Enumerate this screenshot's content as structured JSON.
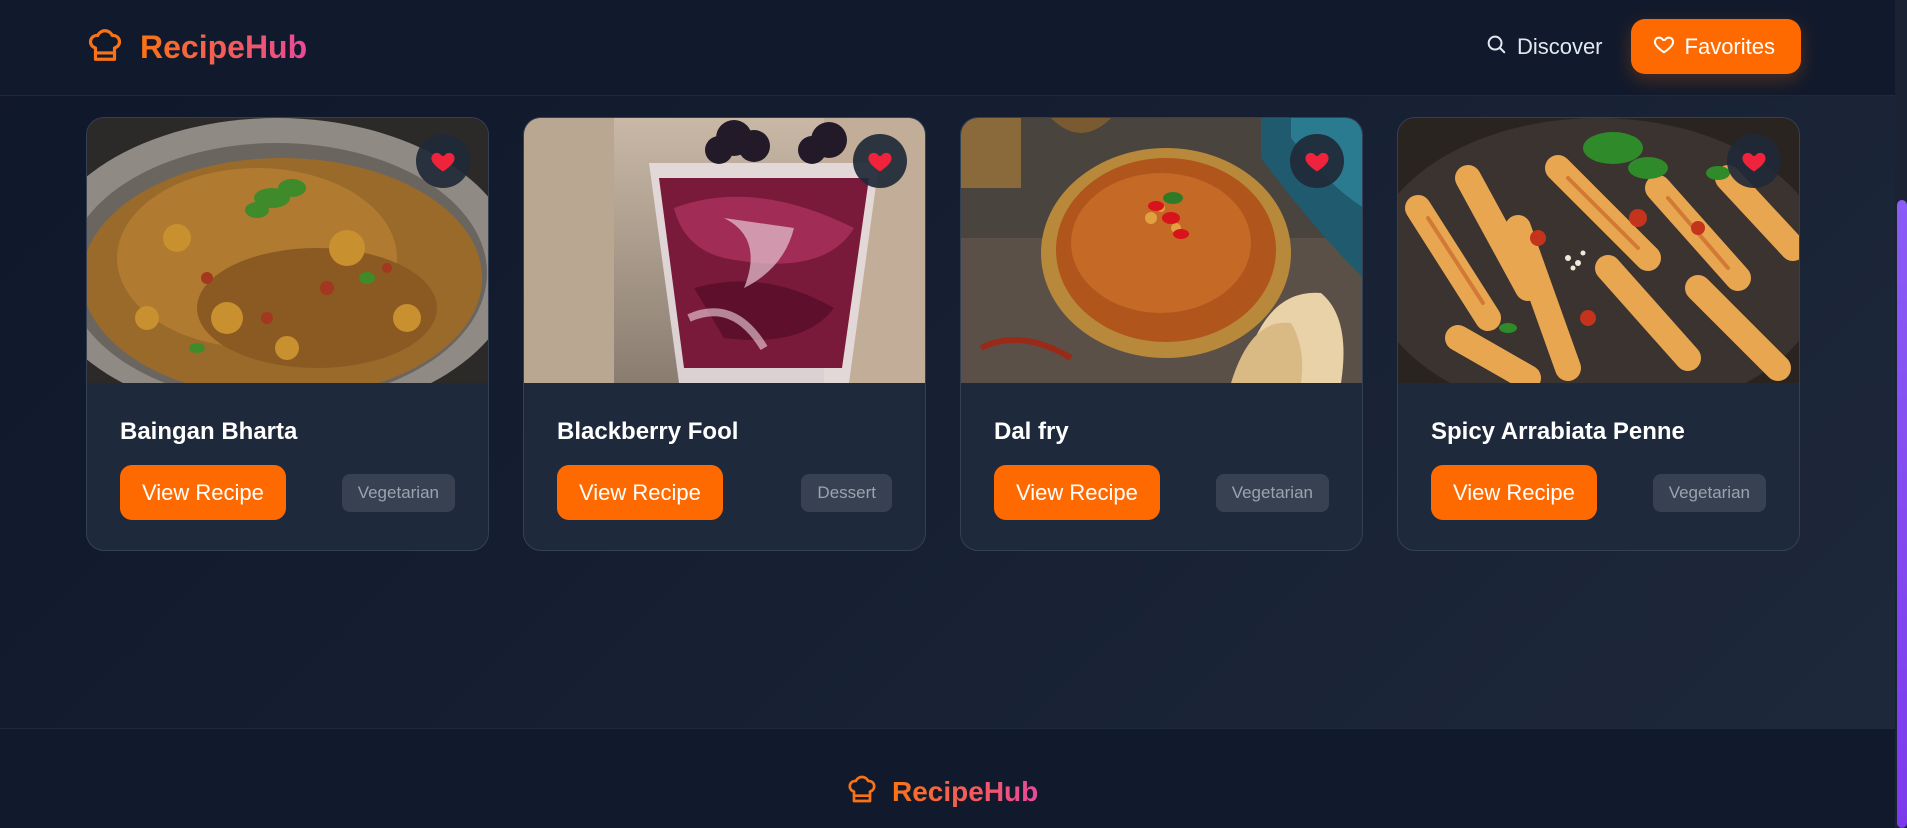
{
  "header": {
    "brand": "RecipeHub",
    "nav": {
      "discover_label": "Discover",
      "favorites_label": "Favorites"
    }
  },
  "recipes": [
    {
      "title": "Baingan Bharta",
      "button_label": "View Recipe",
      "tag": "Vegetarian",
      "image": "baingan-bharta-photo"
    },
    {
      "title": "Blackberry Fool",
      "button_label": "View Recipe",
      "tag": "Dessert",
      "image": "blackberry-fool-photo"
    },
    {
      "title": "Dal fry",
      "button_label": "View Recipe",
      "tag": "Vegetarian",
      "image": "dal-fry-photo"
    },
    {
      "title": "Spicy Arrabiata Penne",
      "button_label": "View Recipe",
      "tag": "Vegetarian",
      "image": "arrabiata-penne-photo"
    }
  ],
  "footer": {
    "brand": "RecipeHub"
  },
  "colors": {
    "accent": "#ff6a00",
    "brand_gradient_start": "#f97316",
    "brand_gradient_end": "#ec4899",
    "favorite_heart": "#ef233c",
    "scrollbar_thumb": "#8b5cf6"
  }
}
